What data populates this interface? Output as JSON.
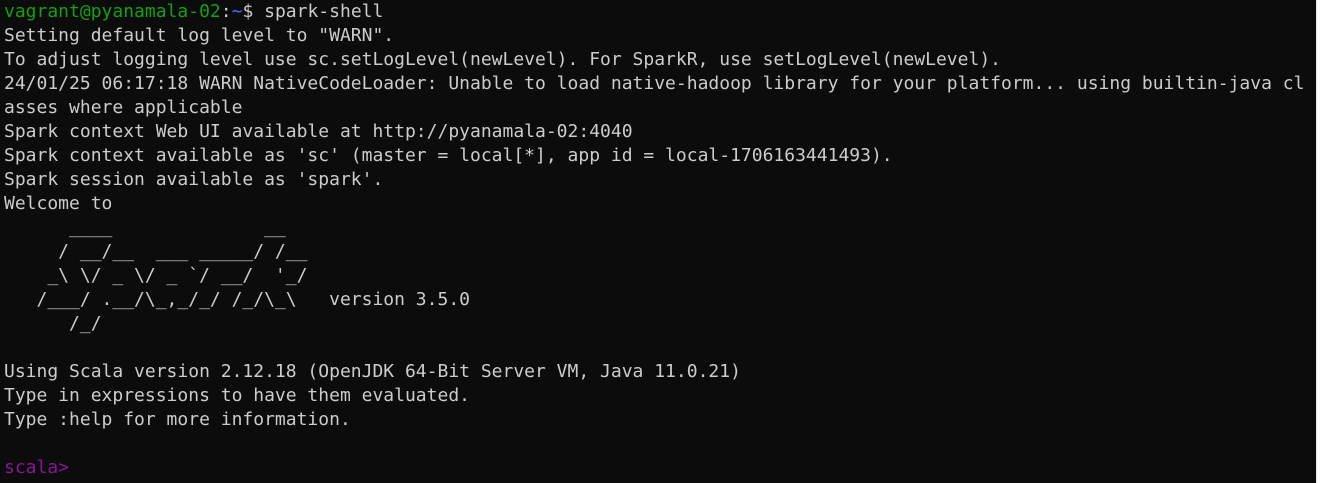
{
  "terminal": {
    "prompt": {
      "user_host": "vagrant@pyanamala-02",
      "separator": ":",
      "path": "~",
      "symbol": "$ ",
      "command": "spark-shell"
    },
    "lines": {
      "l2": "Setting default log level to \"WARN\".",
      "l3": "To adjust logging level use sc.setLogLevel(newLevel). For SparkR, use setLogLevel(newLevel).",
      "l4": "24/01/25 06:17:18 WARN NativeCodeLoader: Unable to load native-hadoop library for your platform... using builtin-java cl",
      "l5": "asses where applicable",
      "l6": "Spark context Web UI available at http://pyanamala-02:4040",
      "l7": "Spark context available as 'sc' (master = local[*], app id = local-1706163441493).",
      "l8": "Spark session available as 'spark'.",
      "l9": "Welcome to",
      "logo1": "      ____              __",
      "logo2": "     / __/__  ___ _____/ /__",
      "logo3": "    _\\ \\/ _ \\/ _ `/ __/  '_/",
      "logo4": "   /___/ .__/\\_,_/_/ /_/\\_\\   version 3.5.0",
      "logo5": "      /_/",
      "l16": "Using Scala version 2.12.18 (OpenJDK 64-Bit Server VM, Java 11.0.21)",
      "l17": "Type in expressions to have them evaluated.",
      "l18": "Type :help for more information."
    },
    "scala_prompt": "scala>",
    "colors": {
      "background": "#0c0c0c",
      "foreground": "#cccccc",
      "user_host": "#13a10e",
      "path": "#3b78ff",
      "scala_prompt": "#881798"
    }
  }
}
